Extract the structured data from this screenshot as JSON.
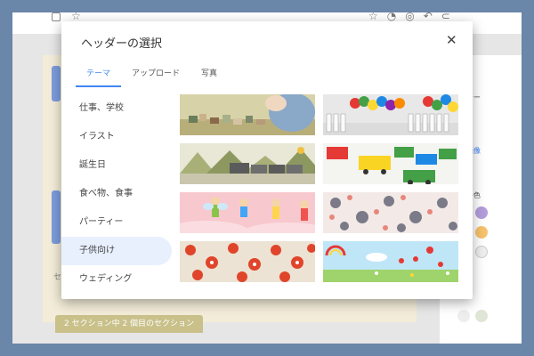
{
  "background": {
    "section_badge": "2 セクション中 2 個目のセクション",
    "partial_label": "セ",
    "right_panel": {
      "t1": "テー",
      "t2": "画像",
      "t3": "の色"
    }
  },
  "dialog": {
    "title": "ヘッダーの選択",
    "close_symbol": "✕",
    "tabs": [
      "テーマ",
      "アップロード",
      "写真"
    ],
    "active_tab": "テーマ",
    "categories": [
      "仕事、学校",
      "イラスト",
      "誕生日",
      "食べ物、食事",
      "パーティー",
      "子供向け",
      "ウェディング"
    ],
    "active_category": "子供向け",
    "thumbnails": [
      "toy-blocks",
      "balloons-fence",
      "train-mountains",
      "cars-trucks",
      "fairies-pink",
      "gray-flowers",
      "red-flowers",
      "ladybugs-meadow"
    ]
  },
  "colors": {
    "accent": "#4285f4",
    "active_bg": "#e8f0fe"
  }
}
